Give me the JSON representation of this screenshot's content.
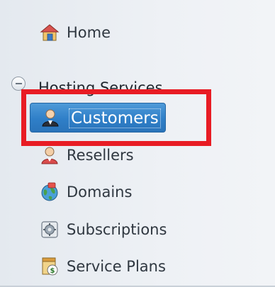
{
  "sidebar": {
    "home_label": "Home",
    "group": {
      "label": "Hosting Services",
      "state": "expanded"
    },
    "items": [
      {
        "label": "Customers",
        "icon": "customer-icon",
        "selected": true
      },
      {
        "label": "Resellers",
        "icon": "reseller-icon",
        "selected": false
      },
      {
        "label": "Domains",
        "icon": "domains-icon",
        "selected": false
      },
      {
        "label": "Subscriptions",
        "icon": "subscriptions-icon",
        "selected": false
      },
      {
        "label": "Service Plans",
        "icon": "service-plans-icon",
        "selected": false
      }
    ]
  },
  "colors": {
    "selected_bg": "#2f7fc8",
    "highlight_border": "#e81c24",
    "text": "#2f3740"
  }
}
